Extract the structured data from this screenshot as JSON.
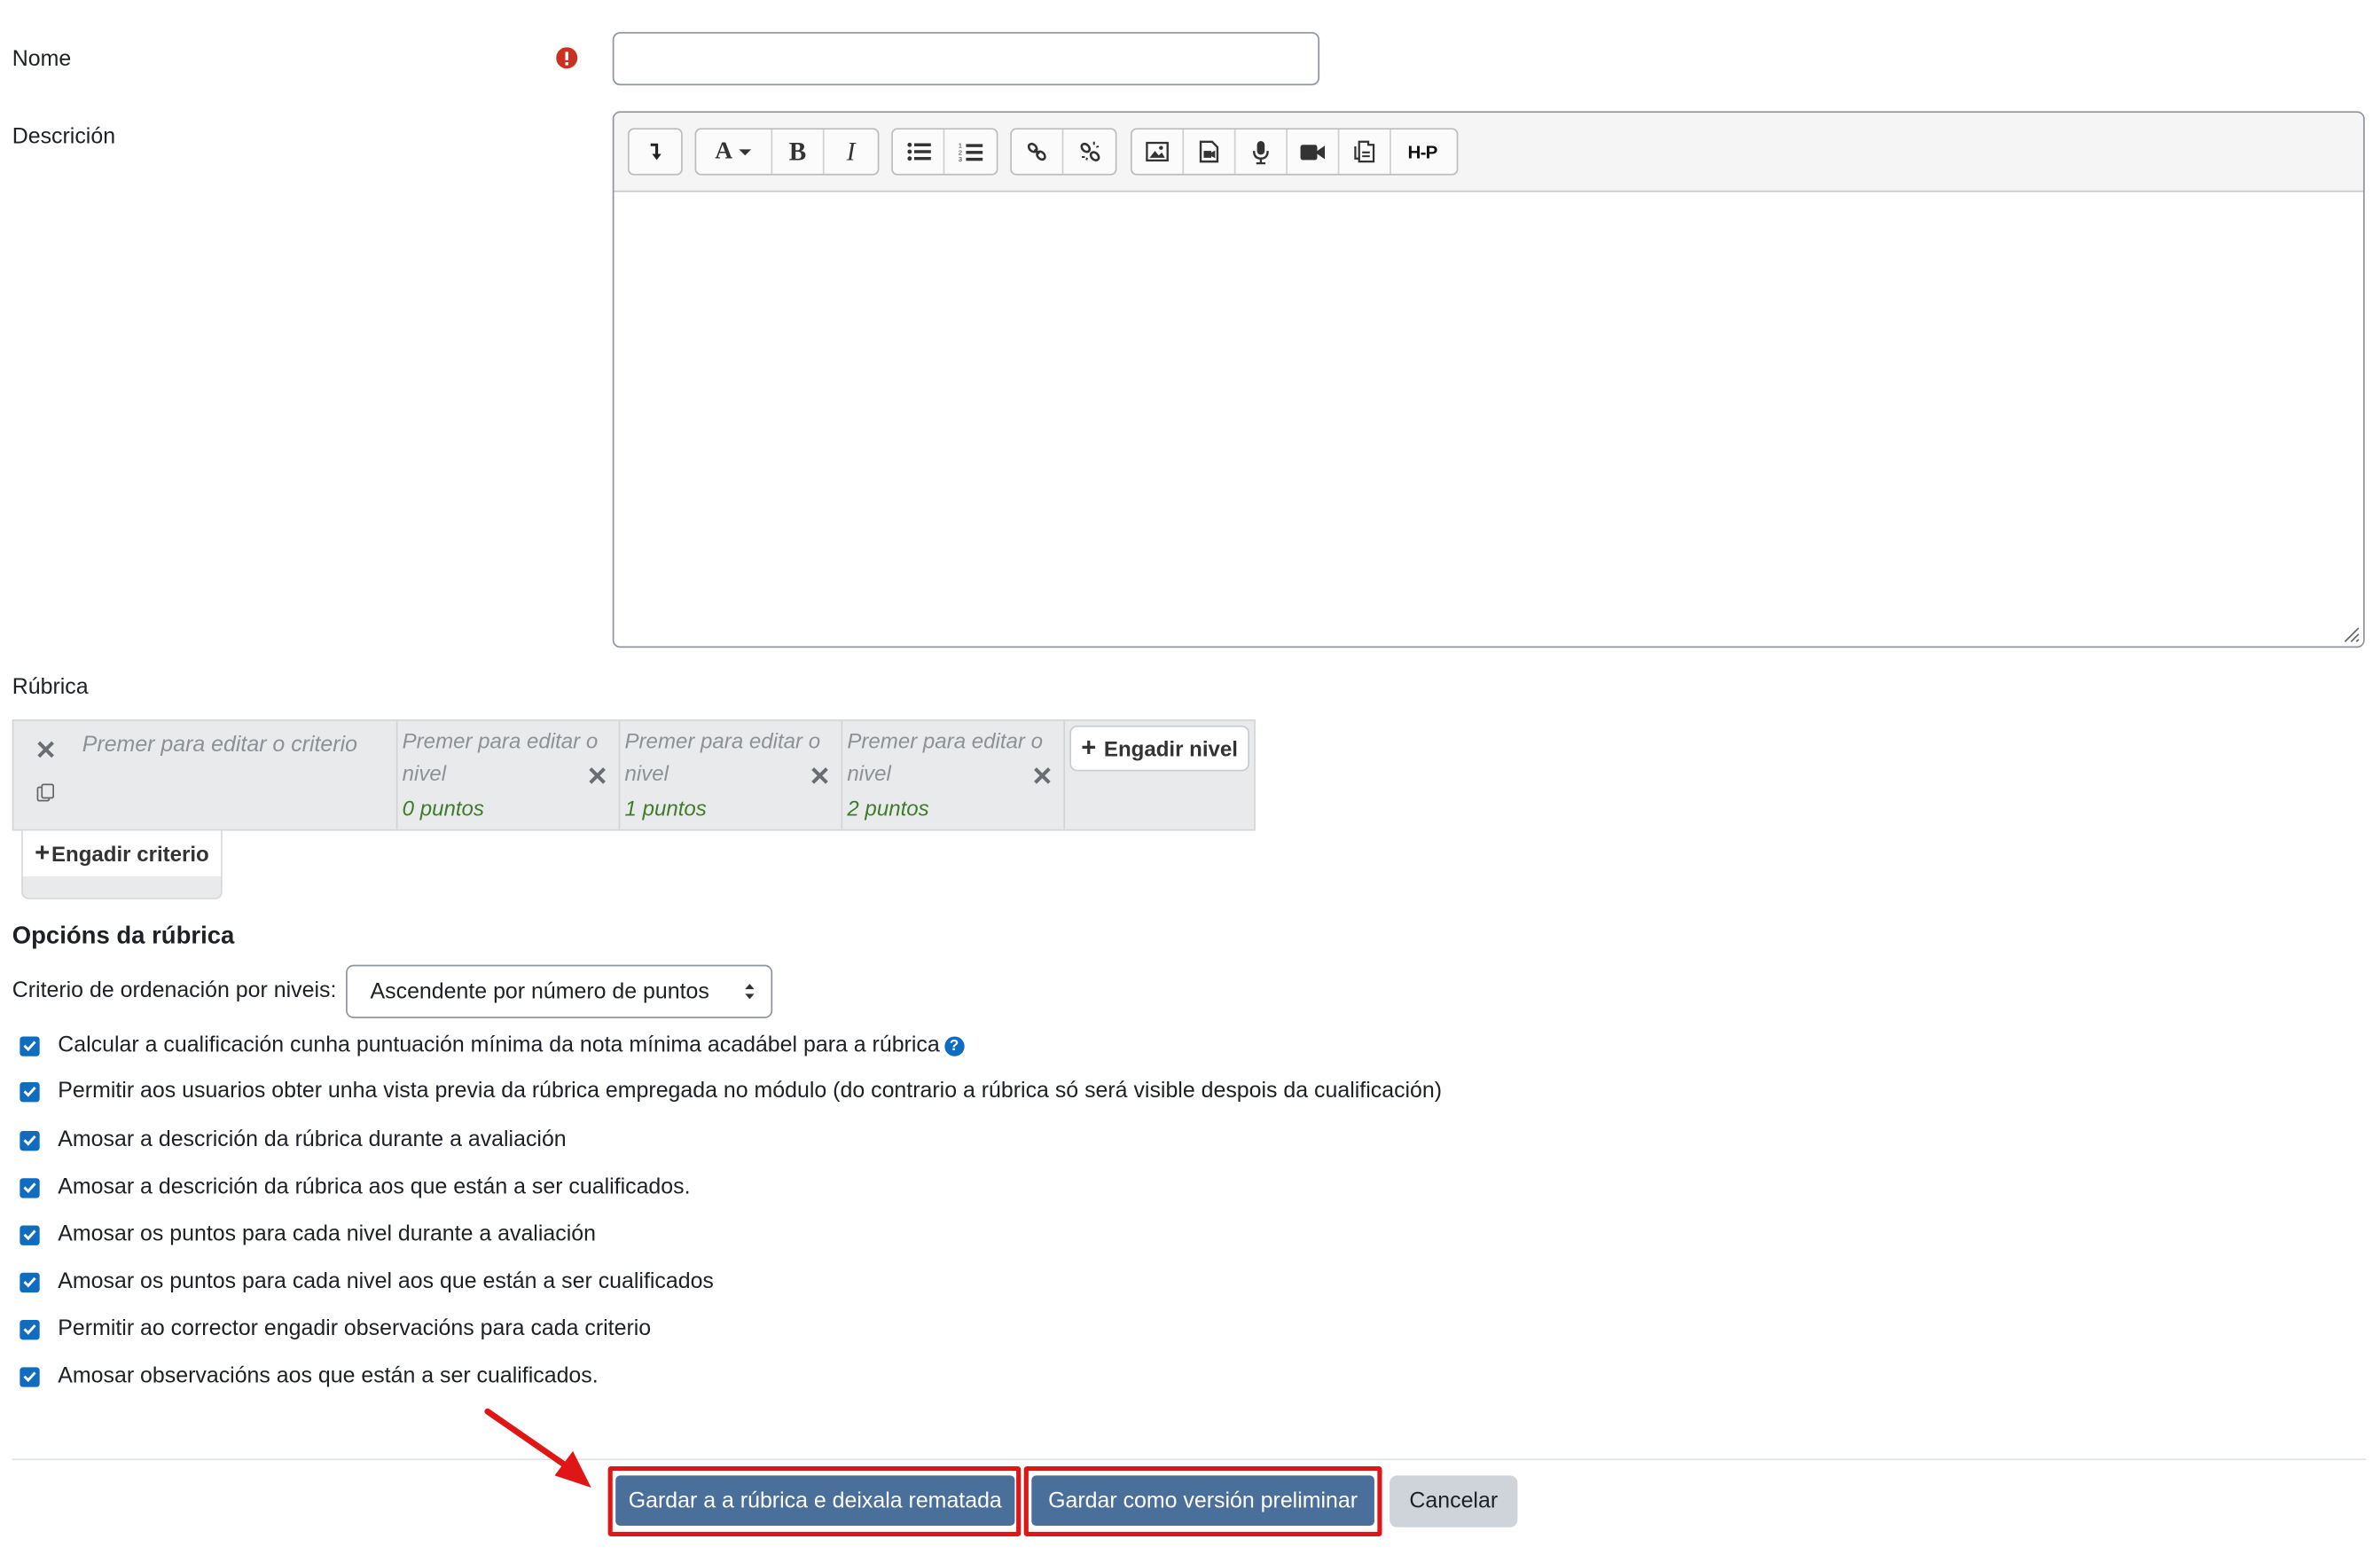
{
  "form": {
    "name_label": "Nome",
    "name_value": "",
    "description_label": "Descrición",
    "editor_toolbar": [
      "show-more-icon",
      "font-style-icon",
      "bold-icon",
      "italic-icon",
      "unordered-list-icon",
      "ordered-list-icon",
      "link-icon",
      "unlink-icon",
      "image-icon",
      "media-icon",
      "record-audio-icon",
      "record-video-icon",
      "manage-files-icon",
      "h5p-icon"
    ],
    "h5p_label": "H-P",
    "bold_label": "B",
    "italic_label": "I",
    "font_label": "A"
  },
  "rubric": {
    "label": "Rúbrica",
    "criterion_placeholder": "Premer para editar o criterio",
    "levels": [
      {
        "placeholder": "Premer para editar o nivel",
        "points": "0 puntos"
      },
      {
        "placeholder": "Premer para editar o nivel",
        "points": "1 puntos"
      },
      {
        "placeholder": "Premer para editar o nivel",
        "points": "2 puntos"
      }
    ],
    "add_level": "Engadir nivel",
    "add_criterion": "Engadir criterio"
  },
  "options": {
    "title": "Opcións da rúbrica",
    "sort_label": "Criterio de ordenación por niveis:",
    "sort_value": "Ascendente por número de puntos",
    "checkboxes": [
      {
        "label": "Calcular a cualificación cunha puntuación mínima da nota mínima acadábel para a rúbrica",
        "checked": true
      },
      {
        "label": "Permitir aos usuarios obter unha vista previa da rúbrica empregada no módulo (do contrario a rúbrica só será visible despois da cualificación)",
        "checked": true
      },
      {
        "label": "Amosar a descrición da rúbrica durante a avaliación",
        "checked": true
      },
      {
        "label": "Amosar a descrición da rúbrica aos que están a ser cualificados.",
        "checked": true
      },
      {
        "label": "Amosar os puntos para cada nivel durante a avaliación",
        "checked": true
      },
      {
        "label": "Amosar os puntos para cada nivel aos que están a ser cualificados",
        "checked": true
      },
      {
        "label": "Permitir ao corrector engadir observacións para cada criterio",
        "checked": true
      },
      {
        "label": "Amosar observacións aos que están a ser cualificados.",
        "checked": true
      }
    ],
    "help_glyph": "?"
  },
  "actions": {
    "save_finish": "Gardar a a rúbrica e deixala rematada",
    "save_draft": "Gardar como versión preliminar",
    "cancel": "Cancelar"
  },
  "colors": {
    "primary": "#4b6f9b",
    "highlight": "#e01515",
    "checkbox": "#0f6cbf",
    "points": "#3f7b2a",
    "required": "#ca3120"
  }
}
